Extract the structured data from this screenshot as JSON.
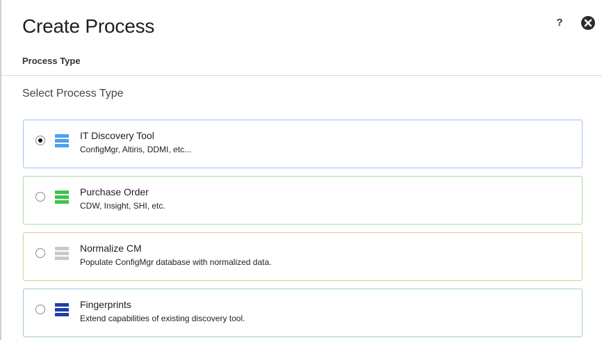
{
  "dialog": {
    "title": "Create Process",
    "subtitle": "Process Type",
    "help_label": "?",
    "section_heading": "Select Process Type"
  },
  "options": [
    {
      "title": "IT Discovery Tool",
      "description": "ConfigMgr, Altiris, DDMI, etc...",
      "selected": true,
      "border_color": "#9ec3ec",
      "icon": "stack-icon",
      "icon_color": "#4aa3f0"
    },
    {
      "title": "Purchase Order",
      "description": "CDW, Insight, SHI, etc.",
      "selected": false,
      "border_color": "#a8dca0",
      "icon": "stack-icon",
      "icon_color": "#3cc44a"
    },
    {
      "title": "Normalize CM",
      "description": "Populate ConfigMgr database with normalized data.",
      "selected": false,
      "border_color": "#d4d28a",
      "icon": "stack-icon",
      "icon_color": "#c9c9c9"
    },
    {
      "title": "Fingerprints",
      "description": "Extend capabilities of existing discovery tool.",
      "selected": false,
      "border_color": "#9fc7d6",
      "icon": "stack-icon",
      "icon_color": "#1f3fa8"
    }
  ]
}
